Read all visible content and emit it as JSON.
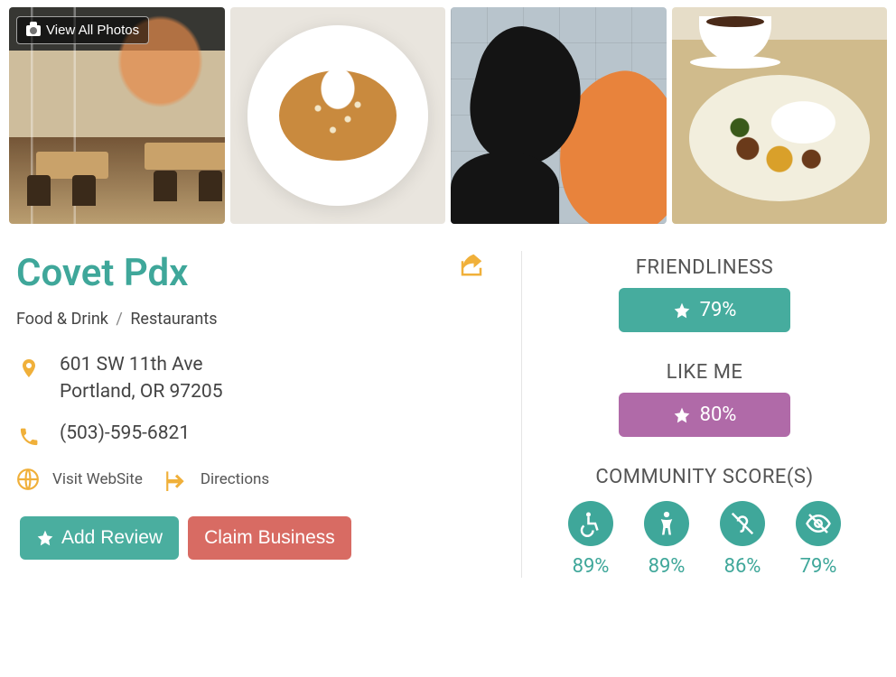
{
  "gallery": {
    "view_all_label": "View All Photos"
  },
  "business": {
    "name": "Covet Pdx",
    "category_parent": "Food & Drink",
    "category": "Restaurants",
    "address_line1": "601 SW 11th Ave",
    "address_line2": "Portland, OR 97205",
    "phone": "(503)-595-6821",
    "website_label": "Visit WebSite",
    "directions_label": "Directions"
  },
  "actions": {
    "add_review": "Add Review",
    "claim_business": "Claim Business"
  },
  "scores": {
    "friendliness": {
      "label": "FRIENDLINESS",
      "value": "79%"
    },
    "likeme": {
      "label": "LIKE ME",
      "value": "80%"
    },
    "community_label": "COMMUNITY SCORE(S)",
    "community": [
      {
        "icon": "wheelchair",
        "value": "89%"
      },
      {
        "icon": "body",
        "value": "89%"
      },
      {
        "icon": "deaf",
        "value": "86%"
      },
      {
        "icon": "low-vision",
        "value": "79%"
      }
    ]
  }
}
